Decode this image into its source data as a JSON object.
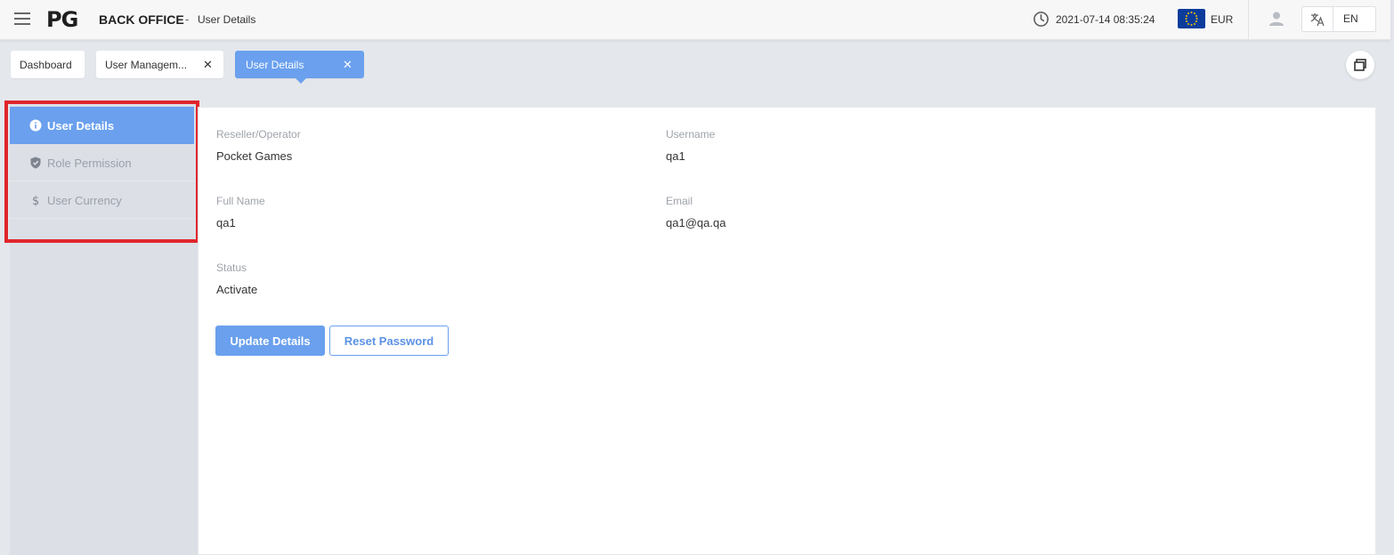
{
  "header": {
    "logo": "PG",
    "app_title": "BACK OFFICE",
    "separator": "-",
    "page": "User Details",
    "datetime": "2021-07-14 08:35:24",
    "currency": "EUR",
    "language": "EN",
    "flag_color": "#0b3c9c"
  },
  "tabs": [
    {
      "label": "Dashboard",
      "closable": false,
      "active": false
    },
    {
      "label": "User Managem...",
      "closable": true,
      "active": false
    },
    {
      "label": "User Details",
      "closable": true,
      "active": true
    }
  ],
  "tab_close_glyph": "✕",
  "side_menu": [
    {
      "label": "User Details",
      "icon": "info-icon",
      "active": true
    },
    {
      "label": "Role Permission",
      "icon": "shield-check-icon",
      "active": false
    },
    {
      "label": "User Currency",
      "icon": "dollar-icon",
      "active": false
    }
  ],
  "details": {
    "reseller_label": "Reseller/Operator",
    "reseller_value": "Pocket Games",
    "username_label": "Username",
    "username_value": "qa1",
    "fullname_label": "Full Name",
    "fullname_value": "qa1",
    "email_label": "Email",
    "email_value": "qa1@qa.qa",
    "status_label": "Status",
    "status_value": "Activate"
  },
  "buttons": {
    "update": "Update Details",
    "reset": "Reset Password"
  },
  "colors": {
    "accent": "#6aa0ee",
    "highlight_border": "#e0252b",
    "sidebar_bg": "#dcdfe6"
  }
}
